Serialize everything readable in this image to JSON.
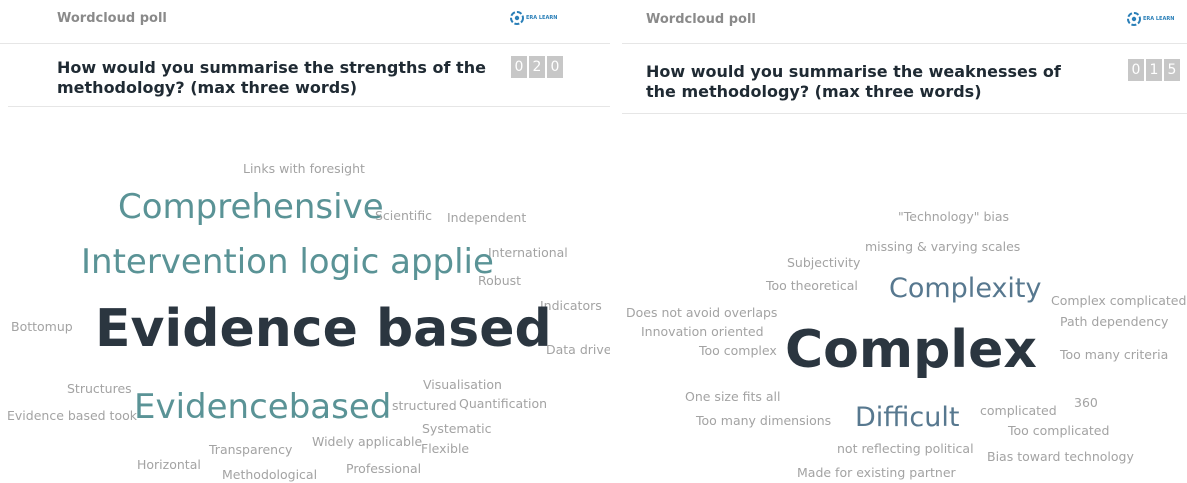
{
  "left": {
    "app_title": "Wordcloud poll",
    "logo_text": "ERA LEARN",
    "question": "How would you summarise the strengths of the methodology? (max three words)",
    "counter": [
      "0",
      "2",
      "0"
    ],
    "words": [
      "Links with foresight",
      "Comprehensive",
      "Scientific",
      "Independent",
      "International",
      "Intervention logic applie",
      "Robust",
      "Indicators",
      "Bottomup",
      "Evidence based",
      "Data driven",
      "Structures",
      "Visualisation",
      "Evidence based took",
      "Evidencebased",
      "structured",
      "Quantification",
      "Systematic",
      "Transparency",
      "Widely applicable",
      "Flexible",
      "Horizontal",
      "Professional",
      "Methodological"
    ]
  },
  "right": {
    "app_title": "Wordcloud poll",
    "logo_text": "ERA LEARN",
    "question": "How would you summarise the weaknesses of the methodology? (max three words)",
    "counter": [
      "0",
      "1",
      "5"
    ],
    "words": [
      "\"Technology\" bias",
      "missing & varying scales",
      "Subjectivity",
      "Too theoretical",
      "Complexity",
      "Complex complicated",
      "Does not avoid overlaps",
      "Path dependency",
      "Innovation oriented",
      "Too complex",
      "Complex",
      "Too many criteria",
      "One size fits all",
      "360",
      "Too many dimensions",
      "Difficult",
      "complicated",
      "Too complicated",
      "not reflecting political",
      "Bias toward technology",
      "Made for existing partner"
    ]
  },
  "colors": {
    "accent_large": "#5a9396",
    "accent_blue": "#57788f",
    "dark_word": "#2b3640",
    "small_word": "#a3a3a3",
    "counter_bg": "#c7c7c7",
    "logo": "#2a7fb8"
  },
  "icons": {
    "logo": "era-learn-logo-icon"
  }
}
